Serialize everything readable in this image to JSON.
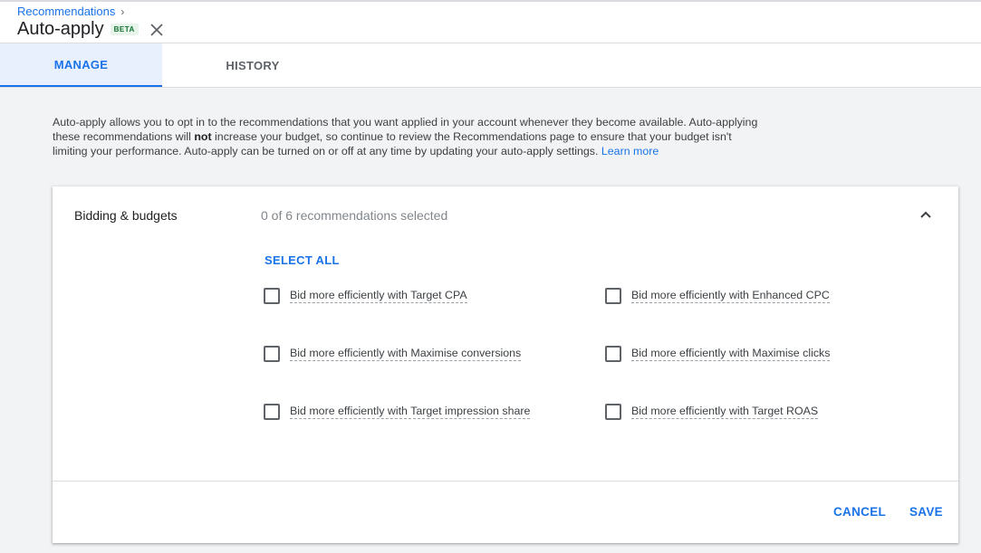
{
  "header": {
    "breadcrumb": "Recommendations",
    "title": "Auto-apply",
    "badge": "BETA"
  },
  "tabs": [
    {
      "label": "MANAGE",
      "active": true
    },
    {
      "label": "HISTORY",
      "active": false
    }
  ],
  "intro": {
    "text_before": "Auto-apply allows you to opt in to the recommendations that you want applied in your account whenever they become available. Auto-applying these recommendations will ",
    "bold": "not",
    "text_after": " increase your budget, so continue to review the Recommendations page to ensure that your budget isn't limiting your performance. Auto-apply can be turned on or off at any time by updating your auto-apply settings. ",
    "link": "Learn more"
  },
  "section": {
    "title": "Bidding & budgets",
    "count": "0 of 6 recommendations selected",
    "select_all": "SELECT ALL",
    "options": [
      {
        "label": "Bid more efficiently with Target CPA",
        "checked": false
      },
      {
        "label": "Bid more efficiently with Enhanced CPC",
        "checked": false
      },
      {
        "label": "Bid more efficiently with Maximise conversions",
        "checked": false
      },
      {
        "label": "Bid more efficiently with Maximise clicks",
        "checked": false
      },
      {
        "label": "Bid more efficiently with Target impression share",
        "checked": false
      },
      {
        "label": "Bid more efficiently with Target ROAS",
        "checked": false
      }
    ]
  },
  "footer": {
    "cancel": "CANCEL",
    "save": "SAVE"
  },
  "colors": {
    "accent": "#1a73e8",
    "active_tab_bg": "#e8f0fe",
    "page_bg": "#f1f3f4"
  },
  "icons": {
    "breadcrumb_separator": "chevron-right-icon",
    "close": "close-icon",
    "collapse": "chevron-up-icon"
  }
}
